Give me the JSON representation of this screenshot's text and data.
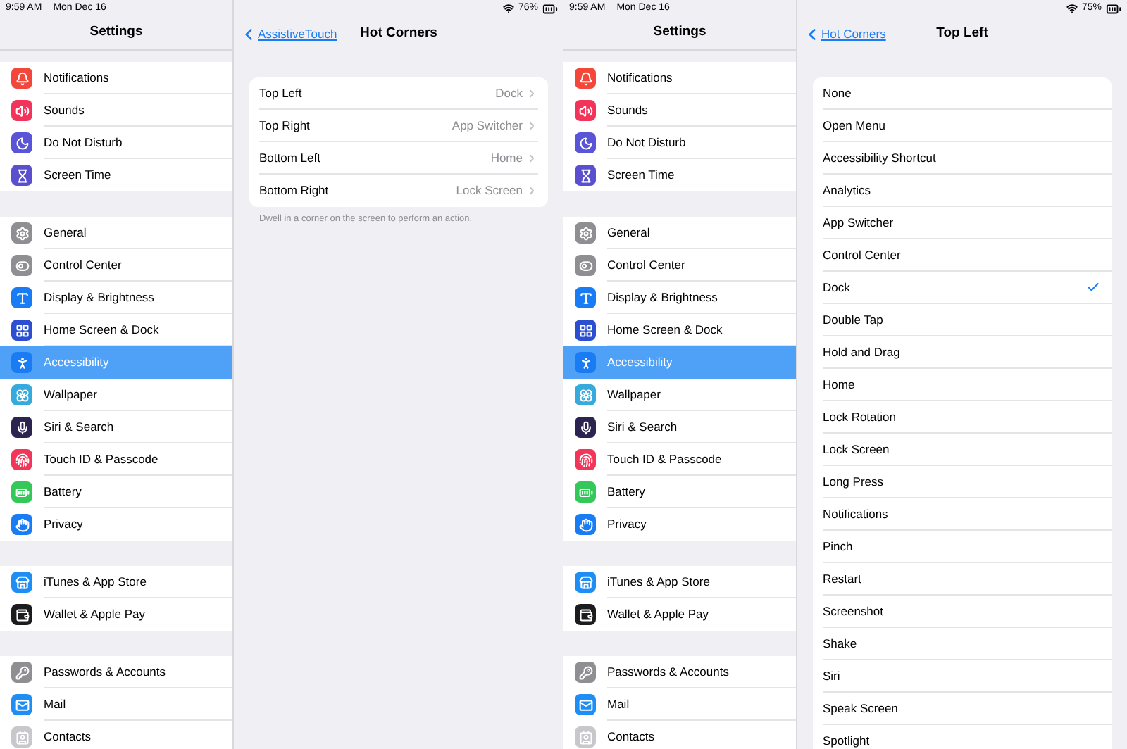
{
  "screens": [
    {
      "status_bar": {
        "time": "9:59 AM",
        "date": "Mon Dec 16",
        "battery": "76%"
      },
      "sidebar": {
        "title": "Settings",
        "groups": [
          [
            {
              "label": "Notifications",
              "selected": false,
              "color": "#f2473a"
            },
            {
              "label": "Sounds",
              "selected": false,
              "color": "#f2335a"
            },
            {
              "label": "Do Not Disturb",
              "selected": false,
              "color": "#5856d6"
            },
            {
              "label": "Screen Time",
              "selected": false,
              "color": "#5a4fcf"
            }
          ],
          [
            {
              "label": "General",
              "selected": false,
              "color": "#8e8e93"
            },
            {
              "label": "Control Center",
              "selected": false,
              "color": "#8e8e93"
            },
            {
              "label": "Display & Brightness",
              "selected": false,
              "color": "#1a7cf5"
            },
            {
              "label": "Home Screen & Dock",
              "selected": false,
              "color": "#2c4fd1"
            },
            {
              "label": "Accessibility",
              "selected": true,
              "color": "#1a7cf5"
            },
            {
              "label": "Wallpaper",
              "selected": false,
              "color": "#36aadc"
            },
            {
              "label": "Siri & Search",
              "selected": false,
              "color": "#2b2350"
            },
            {
              "label": "Touch ID & Passcode",
              "selected": false,
              "color": "#f2365a"
            },
            {
              "label": "Battery",
              "selected": false,
              "color": "#34c759"
            },
            {
              "label": "Privacy",
              "selected": false,
              "color": "#1a7cf5"
            }
          ],
          [
            {
              "label": "iTunes & App Store",
              "selected": false,
              "color": "#1e8ef5"
            },
            {
              "label": "Wallet & Apple Pay",
              "selected": false,
              "color": "#1c1c1e"
            }
          ],
          [
            {
              "label": "Passwords & Accounts",
              "selected": false,
              "color": "#8e8e93"
            },
            {
              "label": "Mail",
              "selected": false,
              "color": "#1e8ef5"
            },
            {
              "label": "Contacts",
              "selected": false,
              "color": "#c7c7cc"
            }
          ]
        ]
      },
      "detail": {
        "back": "AssistiveTouch",
        "title": "Hot Corners",
        "rows": [
          {
            "label": "Top Left",
            "value": "Dock"
          },
          {
            "label": "Top Right",
            "value": "App Switcher"
          },
          {
            "label": "Bottom Left",
            "value": "Home"
          },
          {
            "label": "Bottom Right",
            "value": "Lock Screen"
          }
        ],
        "footer": "Dwell in a corner on the screen to perform an action."
      }
    },
    {
      "status_bar": {
        "time": "9:59 AM",
        "date": "Mon Dec 16",
        "battery": "75%"
      },
      "sidebar": {
        "title": "Settings",
        "groups": [
          [
            {
              "label": "Notifications",
              "selected": false,
              "color": "#f2473a"
            },
            {
              "label": "Sounds",
              "selected": false,
              "color": "#f2335a"
            },
            {
              "label": "Do Not Disturb",
              "selected": false,
              "color": "#5856d6"
            },
            {
              "label": "Screen Time",
              "selected": false,
              "color": "#5a4fcf"
            }
          ],
          [
            {
              "label": "General",
              "selected": false,
              "color": "#8e8e93"
            },
            {
              "label": "Control Center",
              "selected": false,
              "color": "#8e8e93"
            },
            {
              "label": "Display & Brightness",
              "selected": false,
              "color": "#1a7cf5"
            },
            {
              "label": "Home Screen & Dock",
              "selected": false,
              "color": "#2c4fd1"
            },
            {
              "label": "Accessibility",
              "selected": true,
              "color": "#1a7cf5"
            },
            {
              "label": "Wallpaper",
              "selected": false,
              "color": "#36aadc"
            },
            {
              "label": "Siri & Search",
              "selected": false,
              "color": "#2b2350"
            },
            {
              "label": "Touch ID & Passcode",
              "selected": false,
              "color": "#f2365a"
            },
            {
              "label": "Battery",
              "selected": false,
              "color": "#34c759"
            },
            {
              "label": "Privacy",
              "selected": false,
              "color": "#1a7cf5"
            }
          ],
          [
            {
              "label": "iTunes & App Store",
              "selected": false,
              "color": "#1e8ef5"
            },
            {
              "label": "Wallet & Apple Pay",
              "selected": false,
              "color": "#1c1c1e"
            }
          ],
          [
            {
              "label": "Passwords & Accounts",
              "selected": false,
              "color": "#8e8e93"
            },
            {
              "label": "Mail",
              "selected": false,
              "color": "#1e8ef5"
            },
            {
              "label": "Contacts",
              "selected": false,
              "color": "#c7c7cc"
            }
          ]
        ]
      },
      "detail": {
        "back": "Hot Corners",
        "title": "Top Left",
        "options": [
          {
            "label": "None",
            "selected": false
          },
          {
            "label": "Open Menu",
            "selected": false
          },
          {
            "label": "Accessibility Shortcut",
            "selected": false
          },
          {
            "label": "Analytics",
            "selected": false
          },
          {
            "label": "App Switcher",
            "selected": false
          },
          {
            "label": "Control Center",
            "selected": false
          },
          {
            "label": "Dock",
            "selected": true
          },
          {
            "label": "Double Tap",
            "selected": false
          },
          {
            "label": "Hold and Drag",
            "selected": false
          },
          {
            "label": "Home",
            "selected": false
          },
          {
            "label": "Lock Rotation",
            "selected": false
          },
          {
            "label": "Lock Screen",
            "selected": false
          },
          {
            "label": "Long Press",
            "selected": false
          },
          {
            "label": "Notifications",
            "selected": false
          },
          {
            "label": "Pinch",
            "selected": false
          },
          {
            "label": "Restart",
            "selected": false
          },
          {
            "label": "Screenshot",
            "selected": false
          },
          {
            "label": "Shake",
            "selected": false
          },
          {
            "label": "Siri",
            "selected": false
          },
          {
            "label": "Speak Screen",
            "selected": false
          },
          {
            "label": "Spotlight",
            "selected": false
          }
        ]
      }
    }
  ]
}
